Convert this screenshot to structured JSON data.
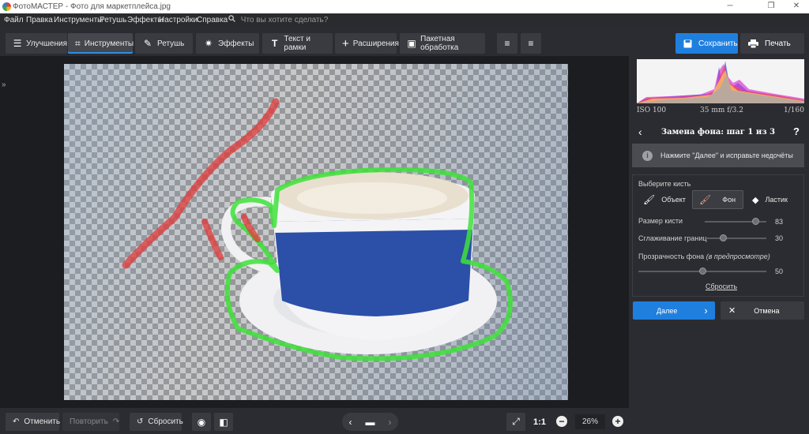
{
  "window": {
    "title": "ФотоМАСТЕР - Фото для маркетплейса.jpg",
    "controls": {
      "minimize": "─",
      "restore": "❐",
      "close": "✕"
    }
  },
  "menu": {
    "items": [
      "Файл",
      "Правка",
      "Инструменты",
      "Ретушь",
      "Эффекты",
      "Настройки",
      "Справка"
    ],
    "search_placeholder": "Что вы хотите сделать?"
  },
  "toolbar": {
    "tabs": [
      {
        "label": "Улучшения",
        "icon": "sliders-icon"
      },
      {
        "label": "Инструменты",
        "icon": "crop-icon",
        "active": true
      },
      {
        "label": "Ретушь",
        "icon": "brush-icon"
      },
      {
        "label": "Эффекты",
        "icon": "sparkle-icon"
      },
      {
        "label": "Текст и рамки",
        "icon": "text-icon"
      },
      {
        "label": "Расширения",
        "icon": "plus-icon"
      },
      {
        "label": "Пакетная обработка",
        "icon": "batch-icon"
      }
    ],
    "save_label": "Сохранить",
    "print_label": "Печать",
    "accent": "#1f7fdf"
  },
  "bottom": {
    "undo_label": "Отменить",
    "redo_label": "Повторить",
    "reset_label": "Сбросить",
    "zoom_ratio": "1:1",
    "zoom": "26%"
  },
  "panel": {
    "exif": {
      "iso": "ISO 100",
      "lens": "35 mm f/3.2",
      "shutter": "1/160"
    },
    "step_title": "Замена фона: шаг 1 из 3",
    "hint": "Нажмите \"Далее\" и исправьте недочёты",
    "choose_brush": "Выберите кисть",
    "brushes": [
      {
        "label": "Объект",
        "icon": "brush-object-icon"
      },
      {
        "label": "Фон",
        "icon": "brush-background-icon",
        "selected": true
      },
      {
        "label": "Ластик",
        "icon": "eraser-icon"
      }
    ],
    "sliders": {
      "brush_size": {
        "label": "Размер кисти",
        "value": "83",
        "fraction": 0.83
      },
      "edge_smoothing": {
        "label": "Сглаживание границ",
        "value": "30",
        "fraction": 0.3
      },
      "bg_opacity": {
        "label": "Прозрачность фона",
        "note": "(в предпросмотре)",
        "value": "50",
        "fraction": 0.5
      }
    },
    "reset_link": "Сбросить",
    "next_label": "Далее",
    "cancel_label": "Отмена"
  },
  "colors": {
    "object_stroke": "#3ee23a",
    "background_stroke": "#e23a3a",
    "cup_band": "#2c4fa8"
  }
}
